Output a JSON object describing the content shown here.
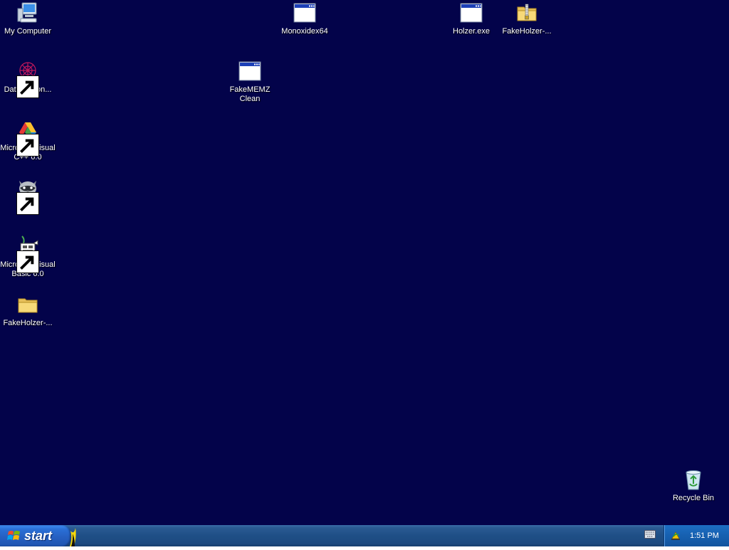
{
  "desktop": {
    "background": "#03034a",
    "icons": [
      {
        "label": "My Computer",
        "icon": "my-computer-icon",
        "shortcut": false
      },
      {
        "label": "DataWagon...",
        "icon": "datawagon-icon",
        "shortcut": true
      },
      {
        "label": "Microsoft Visual\nC++ 6.0",
        "icon": "visual-cpp-icon",
        "shortcut": true
      },
      {
        "label": "Mypal",
        "icon": "mypal-raccoon-icon",
        "shortcut": true
      },
      {
        "label": "Microsoft Visual\nBasic 6.0",
        "icon": "visual-basic-icon",
        "shortcut": true
      },
      {
        "label": "FakeHolzer-...",
        "icon": "folder-icon",
        "shortcut": false
      },
      {
        "label": "FakeMEMZ\nClean",
        "icon": "application-window-icon",
        "shortcut": false
      },
      {
        "label": "Monoxidex64",
        "icon": "application-window-icon",
        "shortcut": false
      },
      {
        "label": "Holzer.exe",
        "icon": "application-window-icon",
        "shortcut": false
      },
      {
        "label": "FakeHolzer-...",
        "icon": "zip-folder-icon",
        "shortcut": false
      },
      {
        "label": "Recycle Bin",
        "icon": "recycle-bin-icon",
        "shortcut": false
      }
    ]
  },
  "taskbar": {
    "start_label": "start",
    "start_icon": "windows-logo-icon",
    "language_icon": "keyboard-icon",
    "tray_icon": "network-update-icon",
    "clock": "1:51 PM",
    "accent": "#2660c2"
  }
}
